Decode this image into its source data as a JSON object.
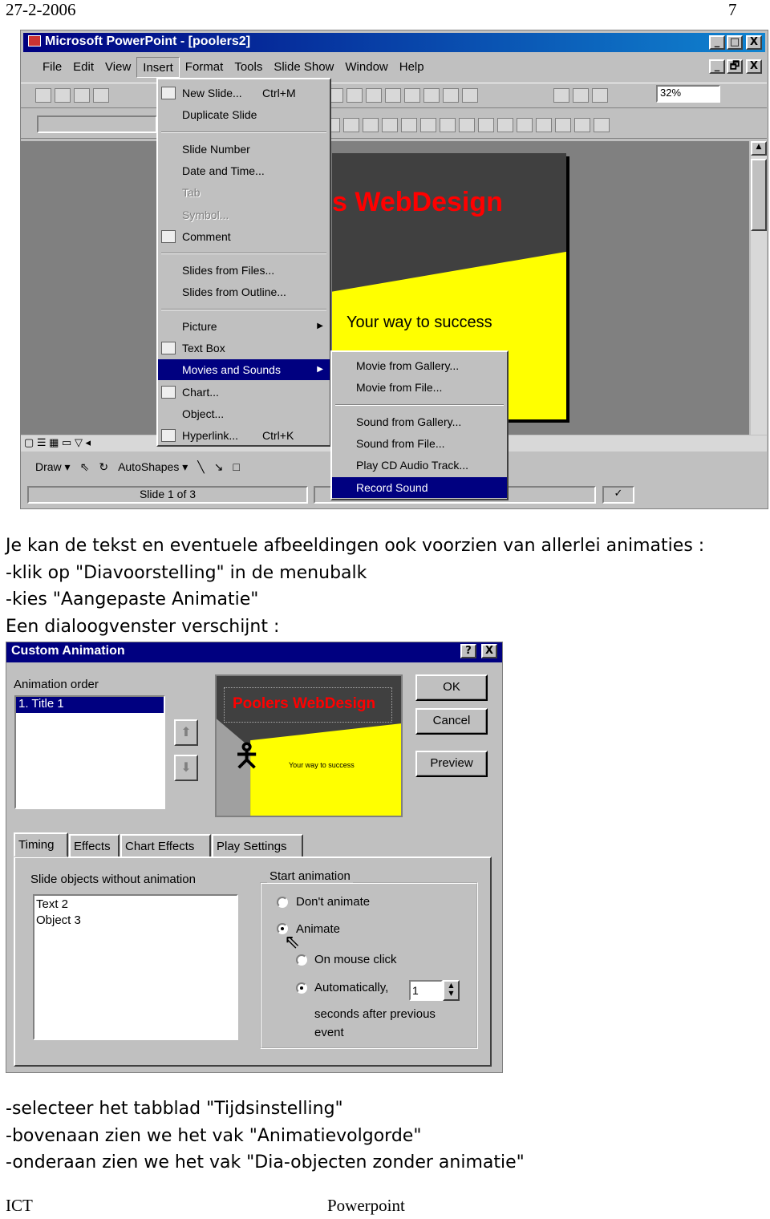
{
  "header": {
    "date": "27-2-2006",
    "page_number": "7"
  },
  "ppt": {
    "title": "Microsoft PowerPoint - [poolers2]",
    "window_buttons": [
      "_",
      "□",
      "X"
    ],
    "doc_buttons": [
      "_",
      "🗗",
      "X"
    ],
    "menubar": [
      "File",
      "Edit",
      "View",
      "Insert",
      "Format",
      "Tools",
      "Slide Show",
      "Window",
      "Help"
    ],
    "zoom": "32%",
    "toolbar_icons": [
      "new",
      "open",
      "save",
      "print",
      "undo",
      "redo",
      "web",
      "web-toolbar",
      "insert-word-table",
      "insert-excel",
      "insert-chart",
      "clip-art",
      "new-slide",
      "layout",
      "background",
      "grayscale",
      "help"
    ],
    "format_icons": [
      "bold",
      "italic",
      "underline",
      "shadow",
      "align-left",
      "center",
      "align-right",
      "bullets",
      "increase-spacing",
      "decrease-spacing",
      "increase-font",
      "decrease-font",
      "promote",
      "demote",
      "animation-effects"
    ],
    "slide": {
      "title_visible": "s WebDesign",
      "subtitle": "Your way to success"
    },
    "insert_menu": [
      {
        "label": "New Slide...",
        "shortcut": "Ctrl+M",
        "icon": "new-slide"
      },
      {
        "label": "Duplicate Slide"
      },
      {
        "sep": true
      },
      {
        "label": "Slide Number"
      },
      {
        "label": "Date and Time..."
      },
      {
        "label": "Tab",
        "disabled": true
      },
      {
        "label": "Symbol...",
        "disabled": true
      },
      {
        "label": "Comment",
        "icon": "comment"
      },
      {
        "sep": true
      },
      {
        "label": "Slides from Files..."
      },
      {
        "label": "Slides from Outline..."
      },
      {
        "sep": true
      },
      {
        "label": "Picture",
        "submenu": true
      },
      {
        "label": "Text Box",
        "icon": "text-box"
      },
      {
        "label": "Movies and Sounds",
        "submenu": true,
        "highlighted": true
      },
      {
        "label": "Chart...",
        "icon": "chart"
      },
      {
        "label": "Object..."
      },
      {
        "label": "Hyperlink...",
        "shortcut": "Ctrl+K",
        "icon": "hyperlink"
      }
    ],
    "movies_submenu": [
      {
        "label": "Movie from Gallery..."
      },
      {
        "label": "Movie from File..."
      },
      {
        "sep": true
      },
      {
        "label": "Sound from Gallery..."
      },
      {
        "label": "Sound from File..."
      },
      {
        "label": "Play CD Audio Track..."
      },
      {
        "label": "Record Sound",
        "highlighted": true
      }
    ],
    "draw_toolbar": {
      "draw": "Draw ▾",
      "autoshapes": "AutoShapes ▾"
    },
    "status": "Slide 1 of 3"
  },
  "body_text_1": [
    "Je kan de tekst en eventuele afbeeldingen ook voorzien van allerlei animaties :",
    "-klik op \"Diavoorstelling\" in de menubalk",
    "-kies \"Aangepaste Animatie\"",
    "Een dialoogvenster verschijnt :"
  ],
  "dialog": {
    "title": "Custom Animation",
    "help": "?",
    "close": "X",
    "animation_order_label": "Animation order",
    "animation_order": [
      "1. Title 1"
    ],
    "preview_title_a": "Poolers",
    "preview_title_b": "WebDesign",
    "preview_subtitle": "Your way to success",
    "ok": "OK",
    "cancel": "Cancel",
    "preview": "Preview",
    "tabs": [
      "Timing",
      "Effects",
      "Chart Effects",
      "Play Settings"
    ],
    "active_tab": "Timing",
    "objects_label": "Slide objects without animation",
    "objects": [
      "Text 2",
      "Object 3"
    ],
    "start_label": "Start animation",
    "dont_animate": "Don't animate",
    "animate": "Animate",
    "on_click": "On mouse click",
    "automatically": "Automatically,",
    "seconds_value": "1",
    "seconds_line1": "seconds after previous",
    "seconds_line2": "event",
    "selected_start": "Animate",
    "selected_trigger": "Automatically"
  },
  "body_text_2": [
    "-selecteer het tabblad \"Tijdsinstelling\"",
    "-bovenaan zien we het vak \"Animatievolgorde\"",
    "-onderaan zien we het vak \"Dia-objecten zonder animatie\""
  ],
  "footer": {
    "left": "ICT",
    "center": "Powerpoint"
  },
  "colors": {
    "titlebar": "#000080",
    "highlight": "#000080",
    "slide_yellow": "#ffff00",
    "slide_dark": "#404040",
    "title_red": "#ff0000"
  }
}
